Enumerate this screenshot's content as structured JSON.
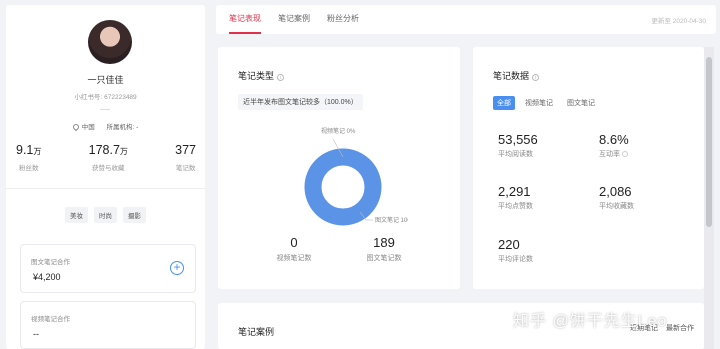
{
  "profile": {
    "name": "一只佳佳",
    "id_label": "小红书号:",
    "id_value": "672223489",
    "location": "中国",
    "org_label": "所属机构:",
    "org_value": "-",
    "stats": [
      {
        "num": "9.1",
        "unit": "万",
        "label": "粉丝数"
      },
      {
        "num": "178.7",
        "unit": "万",
        "label": "获赞与收藏"
      },
      {
        "num": "377",
        "unit": "",
        "label": "笔记数"
      }
    ],
    "tags": [
      "美妆",
      "时尚",
      "摄影"
    ],
    "coop_image": {
      "title": "图文笔记合作",
      "value": "¥4,200"
    },
    "coop_video": {
      "title": "视频笔记合作",
      "value": "--"
    }
  },
  "tabs": [
    {
      "label": "笔记表现",
      "active": true
    },
    {
      "label": "笔记案例",
      "active": false
    },
    {
      "label": "粉丝分析",
      "active": false
    }
  ],
  "update_text": "更新至 2020-04-30",
  "note_type": {
    "title": "笔记类型",
    "summary": "近半年发布图文笔记较多（100.0%）",
    "label_video": "视频笔记 0%",
    "label_image": "图文笔记 100.0%",
    "video_count": "0",
    "video_label": "视频笔记数",
    "image_count": "189",
    "image_label": "图文笔记数",
    "color": "#5b93e6"
  },
  "chart_data": {
    "type": "pie",
    "categories": [
      "视频笔记",
      "图文笔记"
    ],
    "values": [
      0,
      100.0
    ],
    "donut": true
  },
  "note_data": {
    "title": "笔记数据",
    "filters": [
      "全部",
      "视频笔记",
      "图文笔记"
    ],
    "metrics": [
      {
        "value": "53,556",
        "label": "平均阅读数"
      },
      {
        "value": "8.6%",
        "label": "互动率"
      },
      {
        "value": "2,291",
        "label": "平均点赞数"
      },
      {
        "value": "2,086",
        "label": "平均收藏数"
      },
      {
        "value": "220",
        "label": "平均评论数"
      }
    ]
  },
  "note_case": {
    "title": "笔记案例",
    "sort_options": [
      "近期笔记",
      "最新合作"
    ]
  },
  "watermark": "知乎 @饼干先生Leo"
}
